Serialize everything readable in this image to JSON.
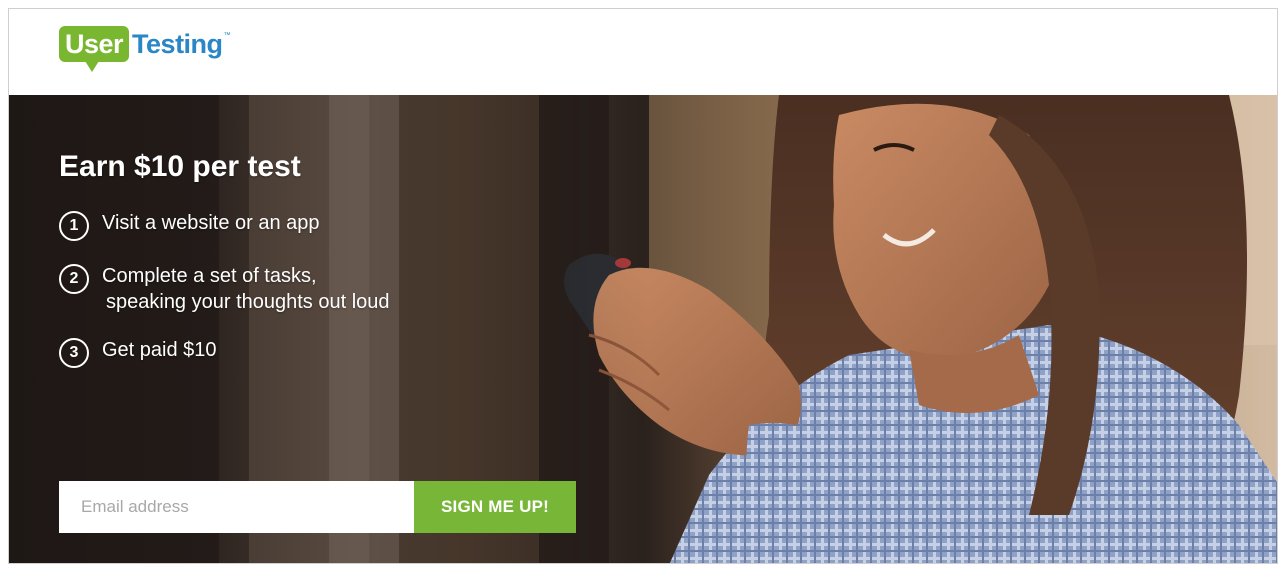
{
  "brand": {
    "logo_user": "User",
    "logo_testing": "Testing",
    "logo_tm": "™",
    "green": "#7ab730",
    "blue": "#2a86c4"
  },
  "hero": {
    "title": "Earn $10 per test",
    "steps": [
      {
        "num": "1",
        "line1": "Visit a website or an app",
        "line2": ""
      },
      {
        "num": "2",
        "line1": "Complete a set of tasks,",
        "line2": "speaking your thoughts out loud"
      },
      {
        "num": "3",
        "line1": "Get paid $10",
        "line2": ""
      }
    ],
    "image": "woman-smiling-at-phone-photo"
  },
  "signup": {
    "email_placeholder": "Email address",
    "email_value": "",
    "button_label": "SIGN ME UP!",
    "button_color": "#78b637"
  }
}
